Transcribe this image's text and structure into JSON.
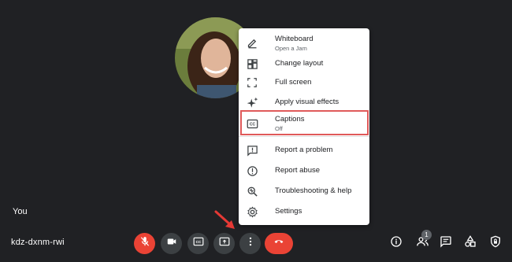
{
  "participant": {
    "name_label": "You"
  },
  "meeting": {
    "code": "kdz-dxnm-rwi"
  },
  "people": {
    "count": "1"
  },
  "menu": {
    "items": [
      {
        "label": "Whiteboard",
        "sublabel": "Open a Jam",
        "icon": "whiteboard-icon"
      },
      {
        "label": "Change layout",
        "icon": "layout-icon"
      },
      {
        "label": "Full screen",
        "icon": "fullscreen-icon"
      },
      {
        "label": "Apply visual effects",
        "icon": "sparkle-icon"
      },
      {
        "label": "Captions",
        "sublabel": "Off",
        "icon": "captions-icon"
      },
      {
        "label": "Report a problem",
        "icon": "feedback-icon"
      },
      {
        "label": "Report abuse",
        "icon": "report-icon"
      },
      {
        "label": "Troubleshooting & help",
        "icon": "troubleshoot-icon"
      },
      {
        "label": "Settings",
        "icon": "gear-icon"
      }
    ]
  },
  "colors": {
    "background": "#202124",
    "control": "#3c4043",
    "danger": "#ea4335",
    "highlight": "#e05a5a",
    "menu_bg": "#ffffff"
  }
}
